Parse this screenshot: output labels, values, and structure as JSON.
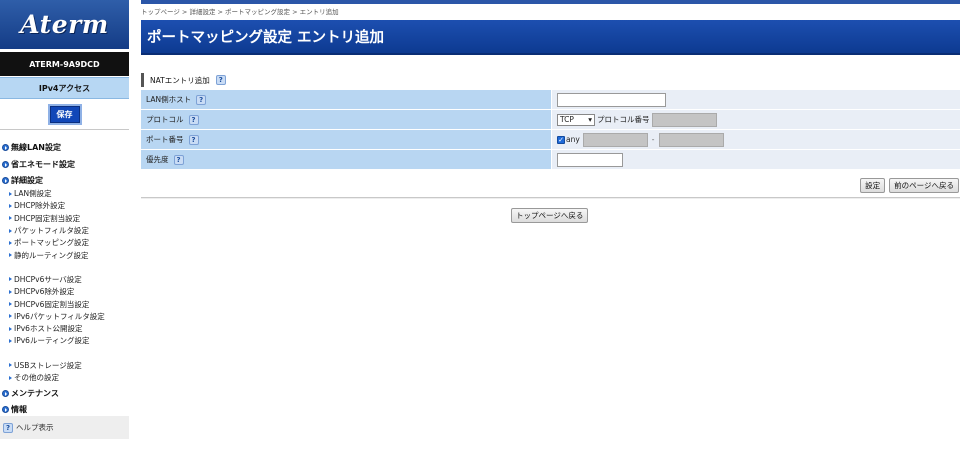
{
  "sidebar": {
    "logo": "Aterm",
    "model": "ATERM-9A9DCD",
    "mode": "IPv4アクセス",
    "save_label": "保存",
    "cat_wireless": "無線LAN設定",
    "cat_eco": "省エネモード設定",
    "cat_detail": "詳細設定",
    "sub1": [
      "LAN側設定",
      "DHCP除外設定",
      "DHCP固定割当設定",
      "パケットフィルタ設定",
      "ポートマッピング設定",
      "静的ルーティング設定"
    ],
    "sub2": [
      "DHCPv6サーバ設定",
      "DHCPv6除外設定",
      "DHCPv6固定割当設定",
      "IPv6パケットフィルタ設定",
      "IPv6ホスト公開設定",
      "IPv6ルーティング設定"
    ],
    "sub3": [
      "USBストレージ設定",
      "その他の設定"
    ],
    "cat_maint": "メンテナンス",
    "cat_info": "情報",
    "help": "ヘルプ表示"
  },
  "main": {
    "breadcrumb": "トップページ > 詳細設定 > ポートマッピング設定 > エントリ追加",
    "title": "ポートマッピング設定 エントリ追加",
    "section": "NATエントリ追加",
    "help_glyph": "?",
    "rows": {
      "lan_host": "LAN側ホスト",
      "protocol": "プロトコル",
      "port": "ポート番号",
      "priority": "優先度"
    },
    "protocol_value": "TCP",
    "protocol_number_label": "プロトコル番号",
    "any_label": "any",
    "port_dash": "-",
    "set_label": "設定",
    "back_label": "前のページへ戻る",
    "top_label": "トップページへ戻る"
  }
}
